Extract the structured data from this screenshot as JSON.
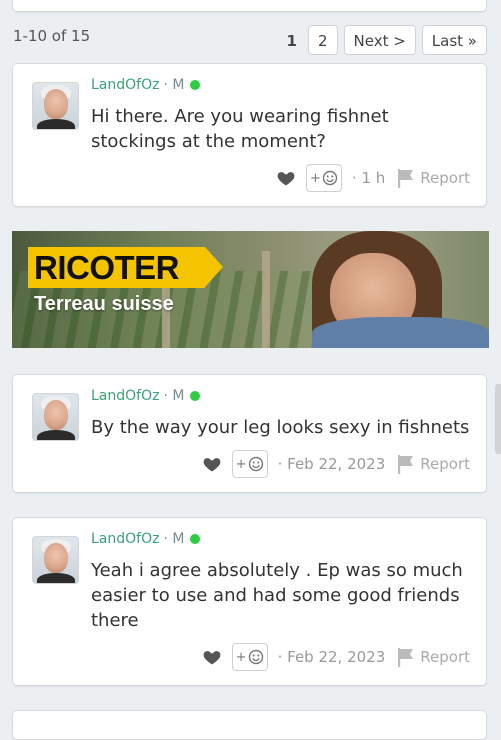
{
  "pagination": {
    "count_label": "1-10 of 15",
    "pages": [
      "1",
      "2"
    ],
    "current_page": "1",
    "next_label": "Next >",
    "last_label": "Last »"
  },
  "ad": {
    "brand": "RICOTER",
    "tagline": "Terreau suisse",
    "brand_color": "#f5c400"
  },
  "comments": [
    {
      "author": "LandOfOz",
      "meta": "· M",
      "online": true,
      "text": "Hi there. Are you wearing fishnet stockings at the moment?",
      "react_label": "+",
      "time": "· 1 h",
      "report_label": "Report"
    },
    {
      "author": "LandOfOz",
      "meta": "· M",
      "online": true,
      "text": "By the way your leg looks sexy in fishnets",
      "react_label": "+",
      "time": "· Feb 22, 2023",
      "report_label": "Report"
    },
    {
      "author": "LandOfOz",
      "meta": "· M",
      "online": true,
      "text": "Yeah i agree absolutely . Ep was so much easier to use and had some good friends there",
      "react_label": "+",
      "time": "· Feb 22, 2023",
      "report_label": "Report"
    }
  ],
  "colors": {
    "author": "#3aa27a",
    "online": "#2ecc40",
    "background": "#eceff2"
  }
}
